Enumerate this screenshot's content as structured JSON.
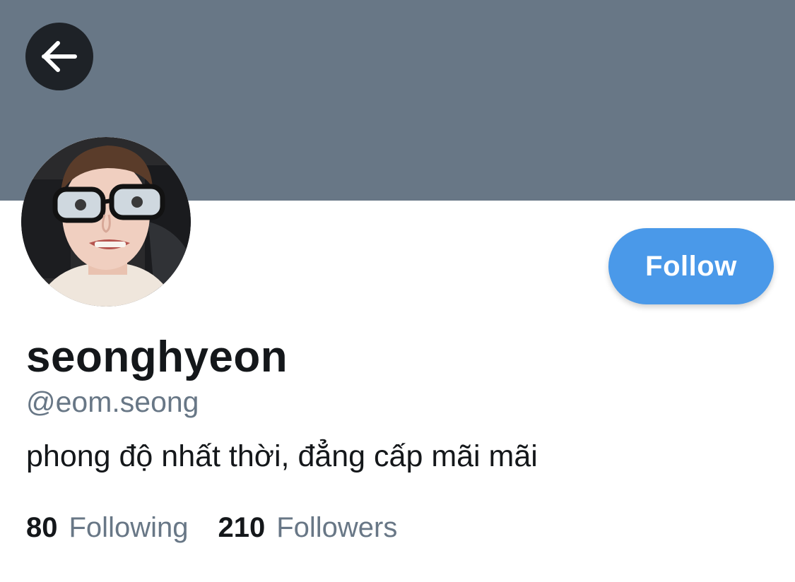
{
  "header": {
    "banner_color": "#687786",
    "back_icon": "arrow-left-icon"
  },
  "profile": {
    "avatar": "profile-photo",
    "display_name": "seonghyeon",
    "handle": "@eom.seong",
    "bio": "phong độ nhất thời, đẳng cấp mãi mãi",
    "follow_label": "Follow",
    "follow_color": "#4a99e9"
  },
  "stats": {
    "following_count": "80",
    "following_label": "Following",
    "followers_count": "210",
    "followers_label": "Followers"
  }
}
